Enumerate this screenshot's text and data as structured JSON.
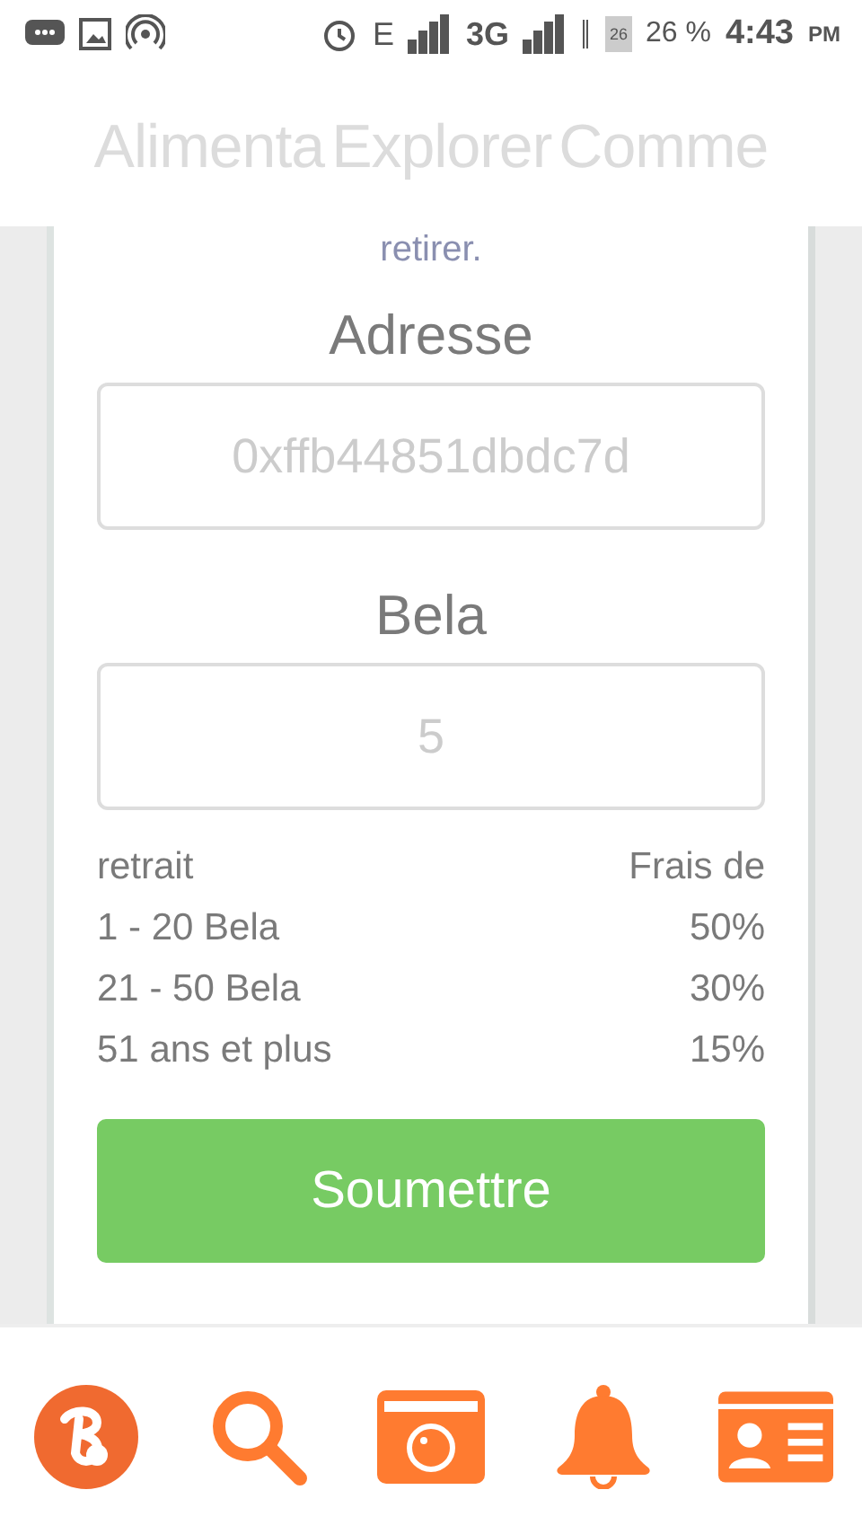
{
  "status_bar": {
    "network": "E",
    "network_2": "3G",
    "battery_icon_text": "26",
    "battery": "26 %",
    "time": "4:43",
    "ampm": "PM"
  },
  "tabs": [
    {
      "label": "Alimenta",
      "selected": false
    },
    {
      "label": "Explorer",
      "selected": false
    },
    {
      "label": "Comme",
      "selected": false
    }
  ],
  "form": {
    "intro_tail": "retirer.",
    "fields": [
      {
        "label": "Adresse",
        "placeholder": "0xffb44851dbdc7d"
      },
      {
        "label": "Bela",
        "placeholder": "5"
      }
    ],
    "fees": {
      "header": [
        "retrait",
        "Frais de"
      ],
      "rows": [
        [
          "1 - 20 Bela",
          "50%"
        ],
        [
          "21 - 50 Bela",
          "30%"
        ],
        [
          "51 ans et plus",
          "15%"
        ]
      ]
    },
    "submit": "Soumettre"
  },
  "bottom_nav": [
    {
      "kind": "logo",
      "selected": false
    },
    {
      "kind": "search",
      "selected": false
    },
    {
      "kind": "camera",
      "selected": false
    },
    {
      "kind": "bell",
      "selected": false
    },
    {
      "kind": "profile",
      "selected": false
    }
  ]
}
